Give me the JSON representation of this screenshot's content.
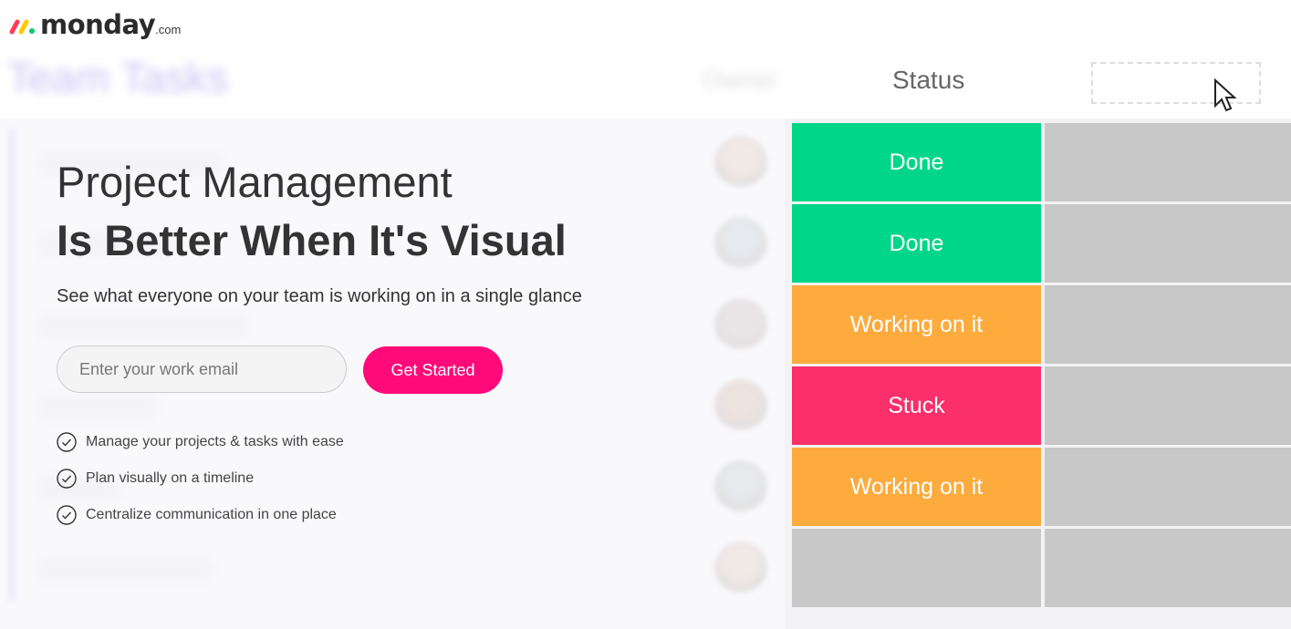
{
  "brand": {
    "name": "monday",
    "suffix": ".com",
    "colors": [
      "#ff3d57",
      "#ffcb00",
      "#00ca72"
    ]
  },
  "board": {
    "title": "Team Tasks",
    "columns": {
      "owner": "Owner",
      "status": "Status"
    },
    "rows": [
      {
        "status": "Done",
        "color": "#00d68a"
      },
      {
        "status": "Done",
        "color": "#00d68a"
      },
      {
        "status": "Working on it",
        "color": "#fdab3d"
      },
      {
        "status": "Stuck",
        "color": "#fb2f6a"
      },
      {
        "status": "Working on it",
        "color": "#fdab3d"
      },
      {
        "status": "",
        "color": "#c8c8c8"
      }
    ]
  },
  "hero": {
    "headline_line1": "Project Management",
    "headline_line2": "Is Better When It's Visual",
    "subtitle": "See what everyone on your team is working on in a single glance",
    "email_placeholder": "Enter your work email",
    "cta_label": "Get Started",
    "accent": "#ff0a78",
    "features": [
      "Manage your projects & tasks with ease",
      "Plan visually on a timeline",
      "Centralize communication in one place"
    ]
  }
}
